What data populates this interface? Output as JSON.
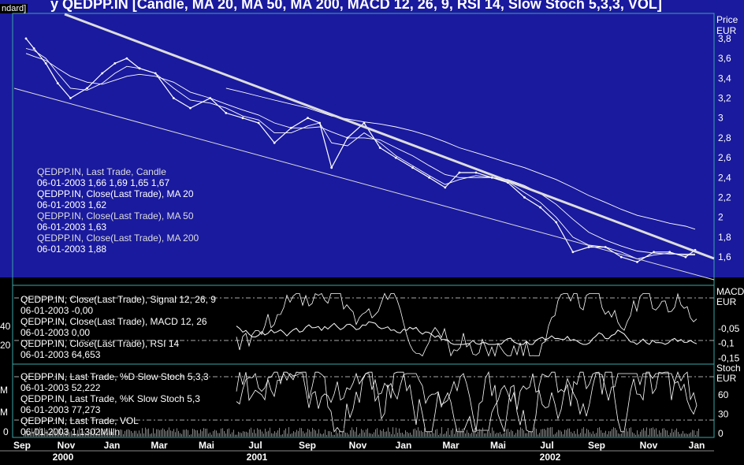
{
  "header": {
    "title": "y QEDPP.IN [Candle, MA 20, MA 50, MA 200, MACD 12, 26, 9, RSI 14, Slow Stoch 5,3,3, VOL]",
    "mode": "ndard]"
  },
  "price_panel": {
    "axis_title": "Price",
    "axis_unit": "EUR",
    "legend": [
      {
        "name": "QEDPP.IN, Last Trade, Candle",
        "value": "06-01-2003 1,66 1,69 1,65 1,67"
      },
      {
        "name": "QEDPP.IN, Close(Last Trade), MA 20",
        "value": "06-01-2003 1,62"
      },
      {
        "name": "QEDPP.IN, Close(Last Trade), MA 50",
        "value": "06-01-2003 1,63"
      },
      {
        "name": "QEDPP.IN, Close(Last Trade), MA 200",
        "value": "06-01-2003 1,88"
      }
    ]
  },
  "macd_panel": {
    "axis_title": "MACD",
    "axis_unit": "EUR",
    "left_ticks": [
      "40",
      "20"
    ],
    "legend": [
      {
        "name": "QEDPP.IN, Close(Last Trade), Signal 12, 26, 9",
        "value": "06-01-2003 -0,00"
      },
      {
        "name": "QEDPP.IN, Close(Last Trade), MACD 12, 26",
        "value": "06-01-2003 0,00"
      },
      {
        "name": "QEDPP.IN, Close(Last Trade), RSI 14",
        "value": "06-01-2003 64,653"
      }
    ]
  },
  "stoch_panel": {
    "axis_title": "Stoch",
    "axis_unit": "EUR",
    "left_ticks": [
      "M",
      "M",
      "0"
    ],
    "legend": [
      {
        "name": "QEDPP.IN, Last Trade, %D Slow Stoch 5,3,3",
        "value": "06-01-2003 52,222"
      },
      {
        "name": "QEDPP.IN, Last Trade, %K Slow Stoch 5,3",
        "value": "06-01-2003 77,273"
      },
      {
        "name": "QEDPP.IN, Last Trade, VOL",
        "value": "06-01-2003 1,1302Milln"
      }
    ]
  },
  "time_axis": {
    "months": [
      "Sep",
      "Nov",
      "Jan",
      "Mar",
      "Mai",
      "Jul",
      "Sep",
      "Nov",
      "Jan",
      "Mar",
      "Mai",
      "Jul",
      "Sep",
      "Nov",
      "Jan"
    ],
    "years": [
      "2000",
      "2001",
      "2002"
    ]
  },
  "colors": {
    "price_bg": "#1a1a9e",
    "panel_bg": "#000000",
    "line": "#ffffff",
    "panel_border": "#3aa6a6"
  },
  "chart_data": [
    {
      "type": "line",
      "name": "price",
      "ylabel": "Price EUR",
      "ylim": [
        1.45,
        3.95
      ],
      "yticks": [
        1.6,
        1.8,
        2,
        2.2,
        2.4,
        2.6,
        2.8,
        3,
        3.2,
        3.4,
        3.6,
        3.8
      ],
      "ytick_labels": [
        "1,6",
        "1,8",
        "2",
        "2,2",
        "2,4",
        "2,6",
        "2,8",
        "3",
        "3,2",
        "3,4",
        "3,6",
        "3,8"
      ],
      "x": [
        "2000-09-15",
        "2000-09-25",
        "2000-10-10",
        "2000-10-25",
        "2000-11-10",
        "2000-12-01",
        "2000-12-20",
        "2001-01-05",
        "2001-01-20",
        "2001-02-05",
        "2001-02-25",
        "2001-03-20",
        "2001-04-10",
        "2001-05-05",
        "2001-05-25",
        "2001-06-15",
        "2001-07-05",
        "2001-07-25",
        "2001-08-15",
        "2001-09-05",
        "2001-09-20",
        "2001-10-05",
        "2001-10-25",
        "2001-11-15",
        "2001-12-05",
        "2001-12-25",
        "2002-01-15",
        "2002-02-05",
        "2002-02-25",
        "2002-03-15",
        "2002-04-05",
        "2002-04-25",
        "2002-05-15",
        "2002-06-05",
        "2002-06-25",
        "2002-07-15",
        "2002-08-05",
        "2002-08-25",
        "2002-09-15",
        "2002-10-05",
        "2002-10-25",
        "2002-11-15",
        "2002-12-05",
        "2002-12-25",
        "2003-01-06"
      ],
      "series": [
        {
          "name": "Candle",
          "values": [
            3.8,
            3.7,
            3.55,
            3.35,
            3.2,
            3.3,
            3.45,
            3.55,
            3.6,
            3.5,
            3.45,
            3.2,
            3.1,
            3.2,
            3.05,
            3.0,
            2.95,
            2.75,
            2.9,
            3.0,
            2.95,
            2.5,
            2.8,
            2.95,
            2.7,
            2.6,
            2.5,
            2.4,
            2.3,
            2.45,
            2.45,
            2.4,
            2.35,
            2.2,
            2.1,
            1.95,
            1.65,
            1.7,
            1.7,
            1.6,
            1.55,
            1.65,
            1.65,
            1.6,
            1.67
          ]
        },
        {
          "name": "MA 20",
          "values": [
            3.7,
            3.68,
            3.6,
            3.45,
            3.3,
            3.28,
            3.35,
            3.45,
            3.52,
            3.5,
            3.45,
            3.3,
            3.18,
            3.15,
            3.1,
            3.02,
            2.98,
            2.85,
            2.85,
            2.92,
            2.95,
            2.75,
            2.72,
            2.85,
            2.75,
            2.62,
            2.52,
            2.42,
            2.33,
            2.38,
            2.42,
            2.4,
            2.36,
            2.25,
            2.15,
            2.0,
            1.8,
            1.72,
            1.7,
            1.65,
            1.58,
            1.62,
            1.64,
            1.62,
            1.62
          ]
        },
        {
          "name": "MA 50",
          "values": [
            3.65,
            3.62,
            3.58,
            3.5,
            3.42,
            3.36,
            3.34,
            3.38,
            3.42,
            3.44,
            3.42,
            3.36,
            3.26,
            3.2,
            3.14,
            3.08,
            3.03,
            2.95,
            2.9,
            2.9,
            2.91,
            2.86,
            2.8,
            2.8,
            2.78,
            2.7,
            2.62,
            2.52,
            2.43,
            2.4,
            2.4,
            2.4,
            2.38,
            2.32,
            2.24,
            2.13,
            1.98,
            1.85,
            1.77,
            1.71,
            1.66,
            1.64,
            1.63,
            1.63,
            1.63
          ]
        },
        {
          "name": "MA 200",
          "values": [
            null,
            null,
            null,
            null,
            null,
            null,
            null,
            null,
            null,
            null,
            null,
            null,
            null,
            null,
            3.3,
            3.26,
            3.22,
            3.18,
            3.14,
            3.1,
            3.06,
            3.02,
            2.99,
            2.96,
            2.94,
            2.91,
            2.87,
            2.82,
            2.76,
            2.7,
            2.65,
            2.6,
            2.55,
            2.5,
            2.44,
            2.38,
            2.3,
            2.22,
            2.15,
            2.08,
            2.02,
            1.98,
            1.94,
            1.91,
            1.88
          ]
        }
      ]
    },
    {
      "type": "line",
      "name": "macd",
      "ylabel": "MACD EUR",
      "ylim": [
        -0.16,
        0.08
      ],
      "yticks": [
        -0.05,
        -0.1,
        -0.15
      ],
      "ytick_labels": [
        "-0,05",
        "-0,1",
        "-0,15"
      ]
    },
    {
      "type": "line",
      "name": "stoch",
      "ylabel": "Stoch EUR",
      "ylim": [
        0,
        100
      ],
      "yticks": [
        0,
        30,
        60
      ],
      "ytick_labels": [
        "0",
        "30",
        "60"
      ]
    }
  ]
}
